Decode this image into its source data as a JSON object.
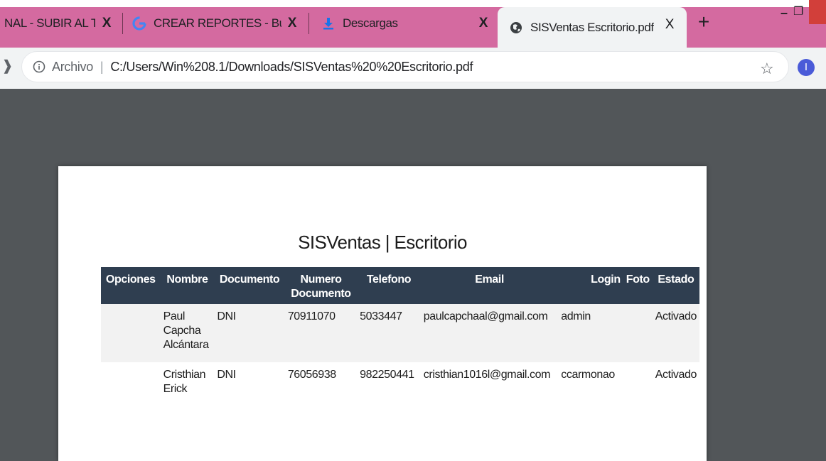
{
  "browser": {
    "tabs": [
      {
        "title": "NAL - SUBIR AL TU",
        "icon": "page-icon"
      },
      {
        "title": "CREAR REPORTES - Buscar",
        "icon": "google-icon"
      },
      {
        "title": "Descargas",
        "icon": "download-icon"
      },
      {
        "title": "SISVentas Escritorio.pdf",
        "icon": "globe-icon",
        "active": true
      }
    ],
    "close_glyph": "X",
    "new_tab_glyph": "+",
    "address": {
      "scheme_label": "Archivo",
      "separator": "|",
      "url": "C:/Users/Win%208.1/Downloads/SISVentas%20%20Escritorio.pdf"
    },
    "profile_initial": "I",
    "colors": {
      "tabstrip": "#d46aa0",
      "toolbar": "#f1f3f4",
      "viewer_bg": "#525659"
    }
  },
  "document": {
    "title": "SISVentas | Escritorio",
    "table": {
      "header_color": "#2f3e50",
      "columns": [
        "Opciones",
        "Nombre",
        "Documento",
        "Numero Documento",
        "Telefono",
        "Email",
        "Login",
        "Foto",
        "Estado"
      ],
      "rows": [
        {
          "opciones": "",
          "nombre": "Paul Capcha Alcántara",
          "documento": "DNI",
          "numero_documento": "70911070",
          "telefono": "5033447",
          "email": "paulcapchaal@gmail.com",
          "login": "admin",
          "foto": "",
          "estado": "Activado"
        },
        {
          "opciones": "",
          "nombre": "Cristhian Erick",
          "documento": "DNI",
          "numero_documento": "76056938",
          "telefono": "982250441",
          "email": "cristhian1016l@gmail.com",
          "login": "ccarmonao",
          "foto": "",
          "estado": "Activado"
        }
      ]
    }
  }
}
